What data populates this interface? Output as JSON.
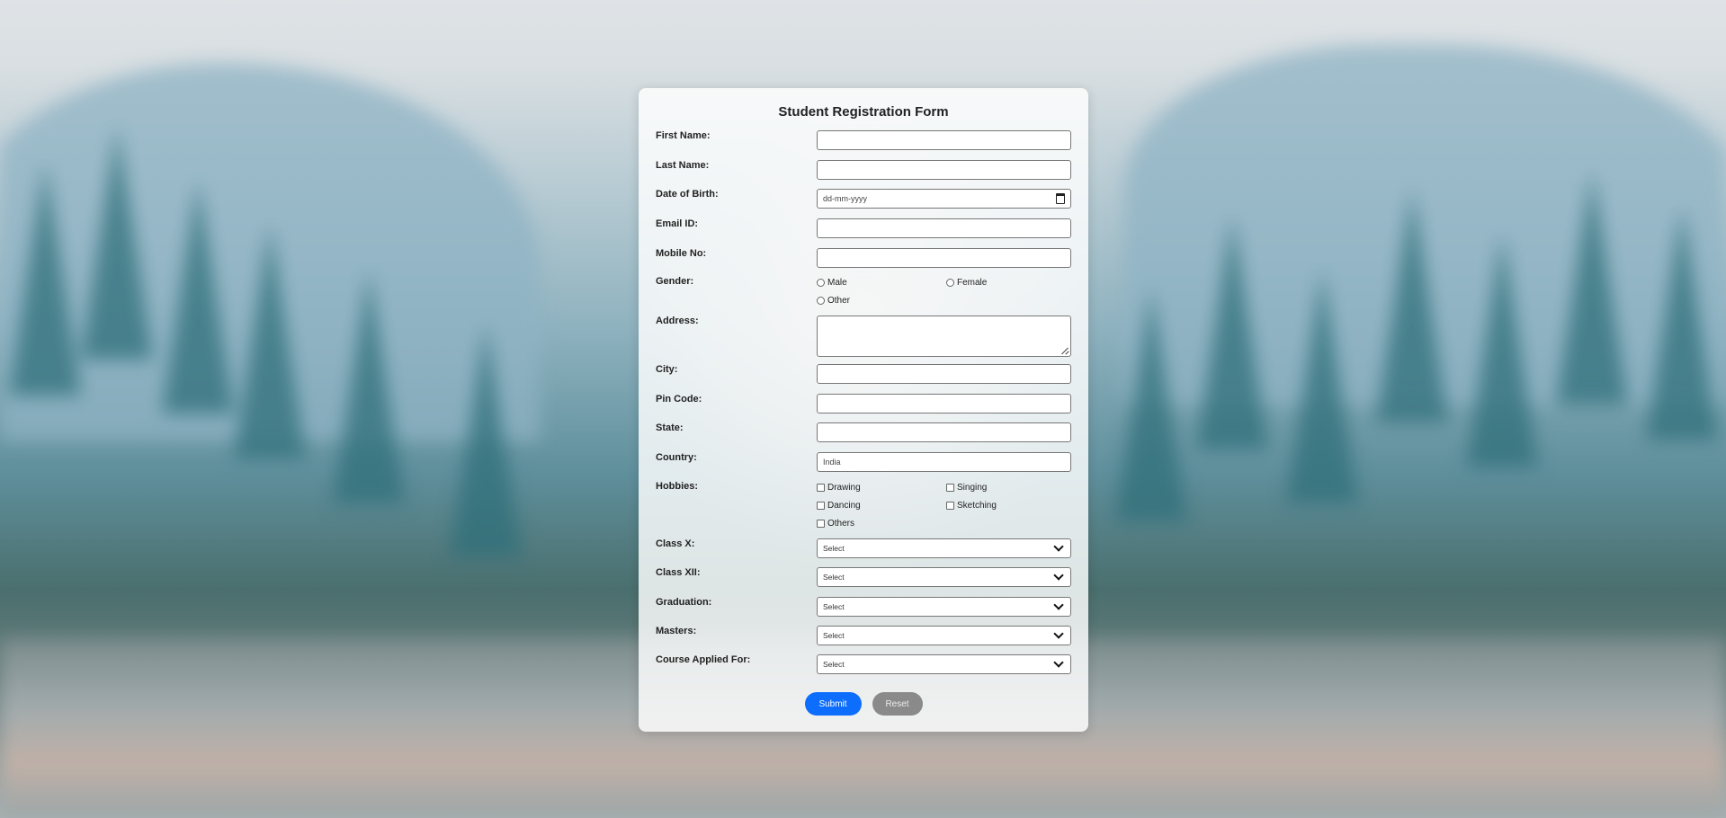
{
  "form": {
    "title": "Student Registration Form",
    "fields": {
      "first_name": {
        "label": "First Name:",
        "value": ""
      },
      "last_name": {
        "label": "Last Name:",
        "value": ""
      },
      "dob": {
        "label": "Date of Birth:",
        "placeholder": "dd-mm-yyyy"
      },
      "email": {
        "label": "Email ID:",
        "value": ""
      },
      "mobile": {
        "label": "Mobile No:",
        "value": ""
      },
      "gender": {
        "label": "Gender:",
        "options": [
          "Male",
          "Female",
          "Other"
        ],
        "selected": null
      },
      "address": {
        "label": "Address:",
        "value": ""
      },
      "city": {
        "label": "City:",
        "value": ""
      },
      "pin": {
        "label": "Pin Code:",
        "value": ""
      },
      "state": {
        "label": "State:",
        "value": ""
      },
      "country": {
        "label": "Country:",
        "value": "India"
      },
      "hobbies": {
        "label": "Hobbies:",
        "options": [
          "Drawing",
          "Singing",
          "Dancing",
          "Sketching",
          "Others"
        ],
        "checked": []
      },
      "class_x": {
        "label": "Class X:",
        "selected": "Select"
      },
      "class_xii": {
        "label": "Class XII:",
        "selected": "Select"
      },
      "graduation": {
        "label": "Graduation:",
        "selected": "Select"
      },
      "masters": {
        "label": "Masters:",
        "selected": "Select"
      },
      "course": {
        "label": "Course Applied For:",
        "selected": "Select"
      }
    },
    "buttons": {
      "submit": "Submit",
      "reset": "Reset"
    }
  },
  "colors": {
    "submit": "#0d6efd",
    "reset": "#8a8a8a",
    "card": "rgba(255,255,255,0.82)"
  }
}
